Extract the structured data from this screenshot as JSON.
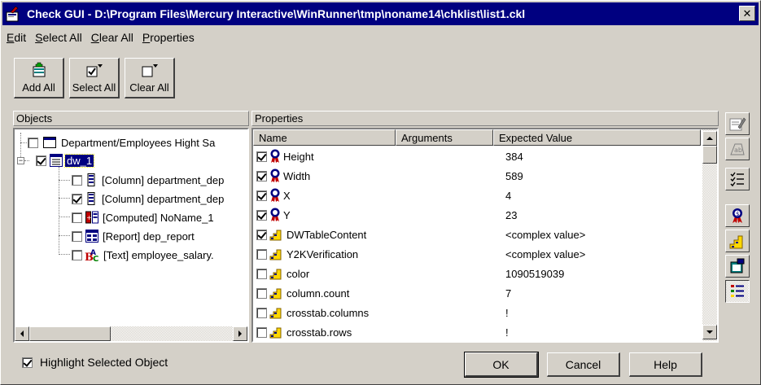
{
  "window": {
    "title": "Check GUI - D:\\Program Files\\Mercury Interactive\\WinRunner\\tmp\\noname14\\chklist\\list1.ckl",
    "close_label": "✕"
  },
  "menu": {
    "items": [
      {
        "label": "Edit",
        "mnemonic": "E",
        "rest": "dit"
      },
      {
        "label": "Select All",
        "mnemonic": "S",
        "rest": "elect All"
      },
      {
        "label": "Clear All",
        "mnemonic": "C",
        "rest": "lear All"
      },
      {
        "label": "Properties",
        "mnemonic": "P",
        "rest": "roperties"
      }
    ]
  },
  "toolbar": {
    "add_all": "Add All",
    "select_all": "Select All",
    "clear_all": "Clear All"
  },
  "objects_panel": {
    "header": "Objects",
    "tree": [
      {
        "label": "Department/Employees Hight Sa",
        "checked": false,
        "icon": "window-icon"
      },
      {
        "label": "dw_1",
        "checked": true,
        "icon": "datawindow-icon",
        "selected": true
      },
      {
        "label": "[Column] department_dep",
        "checked": false,
        "icon": "column-icon"
      },
      {
        "label": "[Column] department_dep",
        "checked": true,
        "icon": "column-icon"
      },
      {
        "label": "[Computed] NoName_1",
        "checked": false,
        "icon": "computed-icon"
      },
      {
        "label": "[Report] dep_report",
        "checked": false,
        "icon": "report-icon"
      },
      {
        "label": "[Text] employee_salary.",
        "checked": false,
        "icon": "text-abc-icon"
      }
    ]
  },
  "properties_panel": {
    "header": "Properties",
    "columns": {
      "name": "Name",
      "arguments": "Arguments",
      "expected": "Expected Value"
    },
    "rows": [
      {
        "name": "Height",
        "value": "384",
        "checked": true,
        "icon": "ribbon-icon"
      },
      {
        "name": "Width",
        "value": "589",
        "checked": true,
        "icon": "ribbon-icon"
      },
      {
        "name": "X",
        "value": "4",
        "checked": true,
        "icon": "ribbon-icon"
      },
      {
        "name": "Y",
        "value": "23",
        "checked": true,
        "icon": "ribbon-icon"
      },
      {
        "name": "DWTableContent",
        "value": "<complex value>",
        "checked": true,
        "icon": "stairs-icon"
      },
      {
        "name": "Y2KVerification",
        "value": "<complex value>",
        "checked": false,
        "icon": "stairs-icon"
      },
      {
        "name": "color",
        "value": "1090519039",
        "checked": false,
        "icon": "stairs-icon"
      },
      {
        "name": "column.count",
        "value": "7",
        "checked": false,
        "icon": "stairs-icon"
      },
      {
        "name": "crosstab.columns",
        "value": "!",
        "checked": false,
        "icon": "stairs-icon"
      },
      {
        "name": "crosstab.rows",
        "value": "!",
        "checked": false,
        "icon": "stairs-icon"
      }
    ]
  },
  "footer": {
    "highlight_label": "Highlight Selected Object",
    "highlight_checked": true,
    "ok": "OK",
    "cancel": "Cancel",
    "help": "Help"
  },
  "colors": {
    "title_bar": "#000080",
    "face": "#d4d0c8",
    "selection": "#000080"
  }
}
